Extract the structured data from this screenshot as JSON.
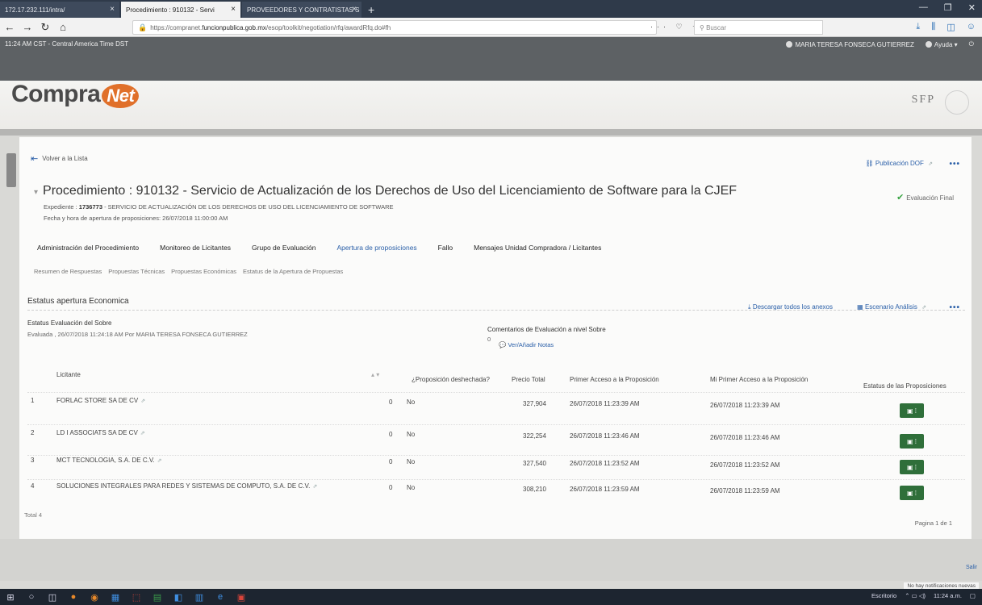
{
  "browser": {
    "tabs": [
      {
        "label": "172.17.232.111/intra/"
      },
      {
        "label": "Procedimiento : 910132 - Servi"
      },
      {
        "label": "PROVEEDORES Y CONTRATISTAS S"
      }
    ],
    "url_prefix": "https://compranet.",
    "url_host": "funcionpublica.gob.mx",
    "url_rest": "/esop/toolkit/negotiation/rfq/awardRfq.do#fh",
    "search_placeholder": "Buscar"
  },
  "app": {
    "clock": "11:24 AM CST - Central America Time DST",
    "user": "MARIA TERESA FONSECA GUTIERREZ",
    "help": "Ayuda",
    "logo_main": "Compra",
    "logo_accent": "Net",
    "sfp": "SFP"
  },
  "header": {
    "back": "Volver a la Lista",
    "publicacion": "Publicación DOF",
    "title": "Procedimiento : 910132 - Servicio de Actualización de los Derechos de Uso del Licenciamiento de Software para la CJEF",
    "eval_final": "Evaluación Final",
    "expediente_label": "Expediente :",
    "expediente_num": "1736773",
    "expediente_desc": "- SERVICIO DE ACTUALIZACIÓN DE LOS DERECHOS DE USO DEL LICENCIAMIENTO DE SOFTWARE",
    "fecha": "Fecha y hora de apertura de proposiciones: 26/07/2018 11:00:00 AM"
  },
  "tabs": [
    "Administración del Procedimiento",
    "Monitoreo de Licitantes",
    "Grupo de Evaluación",
    "Apertura de proposiciones",
    "Fallo",
    "Mensajes Unidad Compradora / Licitantes"
  ],
  "subtabs": [
    "Resumen de Respuestas",
    "Propuestas Técnicas",
    "Propuestas Económicas",
    "Estatus de la Apertura de Propuestas"
  ],
  "section": {
    "title": "Estatus apertura Economica",
    "download": "Descargar todos los anexos",
    "escenario": "Escenario Análisis",
    "estatus_label": "Estatus Evaluación del Sobre",
    "evaluada": "Evaluada , 26/07/2018 11:24:18 AM  Por MARIA TERESA FONSECA GUTIERREZ",
    "comentarios": "Comentarios de Evaluación a nivel Sobre",
    "comentarios_count": "0",
    "ver_notas": "Ver/Añadir Notas"
  },
  "table": {
    "headers": {
      "licitante": "Licitante",
      "desechada": "¿Proposición deshechada?",
      "precio": "Precio Total",
      "primer": "Primer Acceso a la Proposición",
      "mi_primer": "Mi Primer Acceso a la Proposición",
      "estatus": "Estatus de las Proposiciones"
    },
    "rows": [
      {
        "num": "1",
        "name": "FORLAC STORE SA DE CV",
        "zero": "0",
        "des": "No",
        "precio": "327,904",
        "primer": "26/07/2018 11:23:39 AM",
        "mi": "26/07/2018 11:23:39 AM"
      },
      {
        "num": "2",
        "name": "LD I ASSOCIATS SA DE CV",
        "zero": "0",
        "des": "No",
        "precio": "322,254",
        "primer": "26/07/2018 11:23:46 AM",
        "mi": "26/07/2018 11:23:46 AM"
      },
      {
        "num": "3",
        "name": "MCT TECNOLOGIA, S.A. DE C.V.",
        "zero": "0",
        "des": "No",
        "precio": "327,540",
        "primer": "26/07/2018 11:23:52 AM",
        "mi": "26/07/2018 11:23:52 AM"
      },
      {
        "num": "4",
        "name": "SOLUCIONES INTEGRALES PARA REDES Y SISTEMAS DE COMPUTO, S.A. DE C.V.",
        "zero": "0",
        "des": "No",
        "precio": "308,210",
        "primer": "26/07/2018 11:23:59 AM",
        "mi": "26/07/2018 11:23:59 AM"
      }
    ],
    "total": "Total 4",
    "pagina": "Pagina 1 de 1"
  },
  "footer": {
    "notif": "No hay notificaciones nuevas",
    "side_link": "Salir"
  },
  "taskbar": {
    "desktop": "Escritorio",
    "time": "11:24 a.m."
  }
}
